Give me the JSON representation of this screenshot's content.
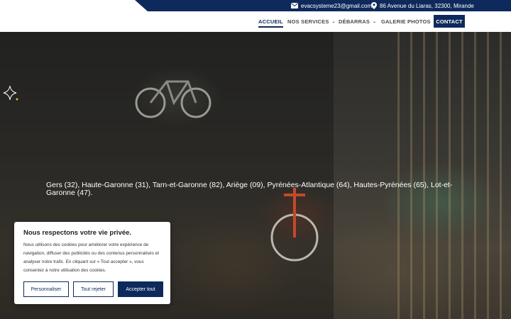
{
  "topbar": {
    "email": "evacsysteme23@gmail.com",
    "address": "86 Avenue du Liaras, 32300, Mirande",
    "email_icon": "envelope-icon",
    "address_icon": "map-pin-icon"
  },
  "nav": {
    "items": [
      {
        "label": "ACCUEIL",
        "active": true
      },
      {
        "label": "NOS SERVICES",
        "dropdown": true
      },
      {
        "label": "DÉBARRAS",
        "dropdown": true
      },
      {
        "label": "GALERIE PHOTOS"
      }
    ],
    "contact_label": "CONTACT"
  },
  "hero": {
    "text": "Gers (32), Haute-Garonne (31), Tarn-et-Garonne (82), Ariège (09), Pyrénées-Atlantique (64), Hautes-Pyrénées (65), Lot-et-Garonne (47)."
  },
  "cookie": {
    "title": "Nous respectons votre vie privée.",
    "text": "Nous utilisons des cookies pour améliorer votre expérience de navigation, diffuser des publicités ou des contenus personnalisés et analyser notre trafic. En cliquant sur « Tout accepter », vous consentez à notre utilisation des cookies.",
    "customize_label": "Personnaliser",
    "reject_label": "Tout rejeter",
    "accept_label": "Accepter tout"
  },
  "colors": {
    "brand": "#0e2a5c",
    "white": "#ffffff"
  }
}
